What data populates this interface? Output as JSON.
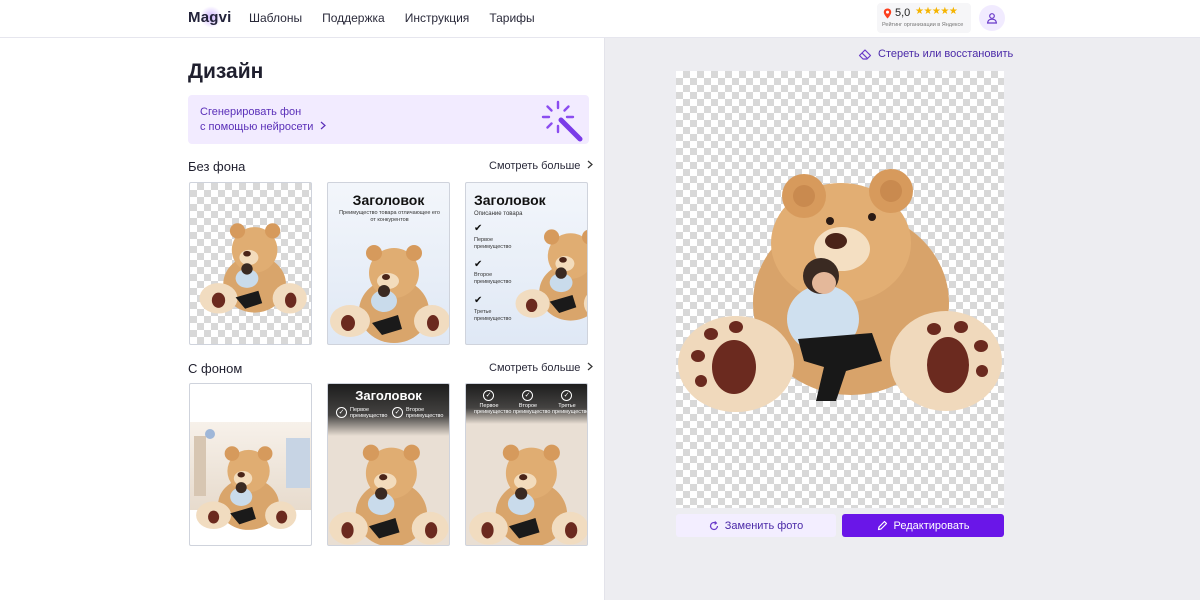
{
  "header": {
    "logo": "Magvi",
    "nav": [
      "Шаблоны",
      "Поддержка",
      "Инструкция",
      "Тарифы"
    ],
    "rating": {
      "score": "5,0",
      "stars": "★★★★★",
      "caption": "Рейтинг организации в Яндексе"
    }
  },
  "page": {
    "title": "Дизайн"
  },
  "generate_banner": {
    "line1": "Сгенерировать фон",
    "line2": "с помощью нейросети"
  },
  "sections": {
    "no_bg": {
      "title": "Без фона",
      "see_more": "Смотреть больше"
    },
    "with_bg": {
      "title": "С фоном",
      "see_more": "Смотреть больше"
    }
  },
  "templates": {
    "t2": {
      "heading": "Заголовок",
      "subtitle": "Преимущество товара отличающее его от конкурентов"
    },
    "t3": {
      "heading": "Заголовок",
      "description": "Описание товара",
      "features": [
        "Первое преимущество",
        "Второе преимущество",
        "Третье преимущество"
      ]
    },
    "t5": {
      "heading": "Заголовок",
      "features": [
        "Первое преимущество",
        "Второе преимущество"
      ]
    },
    "t6": {
      "features": [
        "Первое преимущество",
        "Второе преимущество",
        "Третье преимущество"
      ]
    }
  },
  "editor": {
    "erase_restore": "Стереть или восстановить",
    "replace_photo": "Заменить фото",
    "edit": "Редактировать"
  },
  "colors": {
    "accent": "#6a16e8",
    "accent_soft": "#f2ebff",
    "panel_bg": "#ededf1"
  }
}
